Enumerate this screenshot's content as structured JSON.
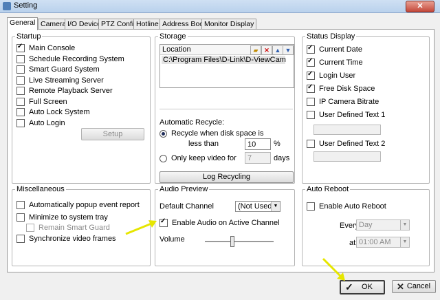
{
  "window": {
    "title": "Setting",
    "close_glyph": "✕"
  },
  "tabs": [
    {
      "label": "General",
      "active": true
    },
    {
      "label": "Camera"
    },
    {
      "label": "I/O Device"
    },
    {
      "label": "PTZ Config"
    },
    {
      "label": "Hotline"
    },
    {
      "label": "Address Book"
    },
    {
      "label": "Monitor Display"
    }
  ],
  "startup": {
    "title": "Startup",
    "items": [
      {
        "label": "Main Console",
        "checked": true
      },
      {
        "label": "Schedule Recording System",
        "checked": false
      },
      {
        "label": "Smart Guard System",
        "checked": false
      },
      {
        "label": "Live Streaming Server",
        "checked": false
      },
      {
        "label": "Remote Playback Server",
        "checked": false
      },
      {
        "label": "Full Screen",
        "checked": false
      },
      {
        "label": "Auto Lock System",
        "checked": false
      },
      {
        "label": "Auto Login",
        "checked": false
      }
    ],
    "setup_label": "Setup"
  },
  "storage": {
    "title": "Storage",
    "location_header": "Location",
    "location_path": "C:\\Program Files\\D-Link\\D-ViewCam",
    "auto_recycle_label": "Automatic Recycle:",
    "recycle_when_label": "Recycle when disk space is",
    "less_than_label": "less than",
    "percent_value": "10",
    "percent_unit": "%",
    "only_keep_label": "Only keep video for",
    "days_value": "7",
    "days_unit": "days",
    "log_recycling_label": "Log Recycling"
  },
  "status_display": {
    "title": "Status Display",
    "items": [
      {
        "label": "Current Date",
        "checked": true
      },
      {
        "label": "Current Time",
        "checked": true
      },
      {
        "label": "Login User",
        "checked": true
      },
      {
        "label": "Free Disk Space",
        "checked": true
      },
      {
        "label": "IP Camera Bitrate",
        "checked": false
      },
      {
        "label": "User Defined Text 1",
        "checked": false
      },
      {
        "label": "User Defined Text 2",
        "checked": false
      }
    ]
  },
  "misc": {
    "title": "Miscellaneous",
    "items": [
      {
        "label": "Automatically popup event report",
        "checked": false
      },
      {
        "label": "Minimize to system tray",
        "checked": false
      },
      {
        "label": "Remain Smart Guard",
        "checked": false,
        "disabled": true
      },
      {
        "label": "Synchronize video frames",
        "checked": false
      }
    ]
  },
  "audio": {
    "title": "Audio Preview",
    "default_channel_label": "Default Channel",
    "default_channel_value": "(Not Used)",
    "enable_audio_label": "Enable Audio on Active Channel",
    "volume_label": "Volume"
  },
  "auto_reboot": {
    "title": "Auto Reboot",
    "enable_label": "Enable Auto Reboot",
    "every_label": "Every",
    "every_value": "Day",
    "at_label": "at",
    "at_value": "01:00 AM"
  },
  "footer": {
    "ok_label": "OK",
    "cancel_label": "Cancel"
  },
  "colors": {
    "highlight_arrow": "#e6e600",
    "title_bar": "#b9d1ec"
  }
}
